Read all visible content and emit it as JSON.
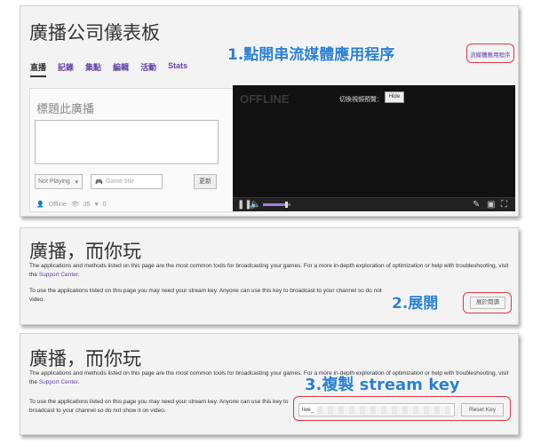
{
  "panel1": {
    "title": "廣播公司儀表板",
    "tabs": [
      {
        "label": "直播",
        "active": true
      },
      {
        "label": "記錄",
        "active": false
      },
      {
        "label": "集點",
        "active": false
      },
      {
        "label": "編輯",
        "active": false
      },
      {
        "label": "活動",
        "active": false
      },
      {
        "label": "Stats",
        "active": false
      }
    ],
    "annotation": "1.點開串流媒體應用程序",
    "app_button_label": "流媒體應用程序",
    "stream_card": {
      "title_placeholder": "標題此廣播",
      "game_select": "Not Playing",
      "game_placeholder": "Game title",
      "update_label": "更新",
      "status": "Offline",
      "viewers": "35",
      "hearts": "0"
    },
    "player": {
      "offline_label": "OFFLINE",
      "preview_label": "切換視頻預覽：",
      "hide_label": "Hide",
      "volume_level": 0.85
    }
  },
  "panel2": {
    "title": "廣播，而你玩",
    "para1": "The applications and methods listed on this page are the most common tools for broadcasting your games. For a more in-depth exploration of optimization or help with troubleshooting, visit the",
    "link": "Support Center",
    "para1_end": ".",
    "para2_a": "To use the applications listed on this page you may need your stream key. Anyone can use this key to broadcast to your channel so do not",
    "para2_b": "video.",
    "annotation": "2.展開",
    "expand_label": "展於閱讀"
  },
  "panel3": {
    "title": "廣播，而你玩",
    "para1": "The applications and methods listed on this page are the most common tools for broadcasting your games. For a more in-depth exploration of optimization or help with troubleshooting, visit the",
    "link": "Support Center",
    "para1_end": ".",
    "para2": "To use the applications listed on this page you may need your stream key. Anyone can use this key to broadcast to your channel so do not show it on video.",
    "annotation": "3.複製 stream key",
    "key_prefix": "live_",
    "reset_label": "Reset Key"
  },
  "colors": {
    "accent_purple": "#6441a5",
    "annotation_blue": "#2a7fd4",
    "annotation_red": "#d83a4a"
  }
}
